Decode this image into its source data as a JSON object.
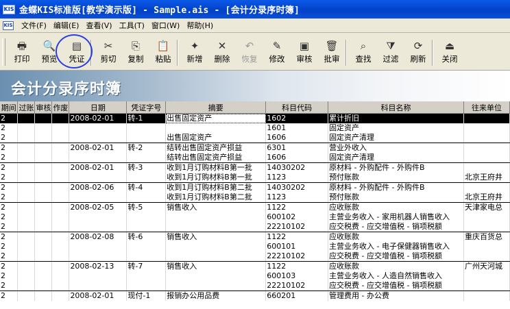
{
  "window": {
    "title": "金蝶KIS标准版[教学演示版] - Sample.ais - [会计分录序时簿]",
    "icon_text": "KIS"
  },
  "menu": {
    "doc_icon_text": "KIS",
    "items": [
      "文件(F)",
      "编辑(E)",
      "查看(V)",
      "工具(T)",
      "窗口(W)",
      "帮助(H)"
    ]
  },
  "toolbar": {
    "buttons": [
      {
        "label": "打印",
        "icon": "printer-icon",
        "glyph": "🖶",
        "disabled": false
      },
      {
        "label": "预览",
        "icon": "preview-icon",
        "glyph": "🔍",
        "disabled": false
      },
      {
        "label": "凭证",
        "icon": "voucher-icon",
        "glyph": "▤",
        "disabled": false
      },
      {
        "label": "剪切",
        "icon": "cut-icon",
        "glyph": "✂",
        "disabled": false
      },
      {
        "label": "复制",
        "icon": "copy-icon",
        "glyph": "⎘",
        "disabled": false
      },
      {
        "label": "粘贴",
        "icon": "paste-icon",
        "glyph": "📋",
        "disabled": false
      },
      {
        "label": "新增",
        "icon": "new-icon",
        "glyph": "✦",
        "disabled": false
      },
      {
        "label": "删除",
        "icon": "delete-icon",
        "glyph": "✕",
        "disabled": false
      },
      {
        "label": "恢复",
        "icon": "restore-icon",
        "glyph": "↶",
        "disabled": true
      },
      {
        "label": "修改",
        "icon": "edit-icon",
        "glyph": "✎",
        "disabled": false
      },
      {
        "label": "审核",
        "icon": "audit-icon",
        "glyph": "▣",
        "disabled": false
      },
      {
        "label": "批审",
        "icon": "batch-audit-icon",
        "glyph": "🗑",
        "disabled": false
      },
      {
        "label": "查找",
        "icon": "find-icon",
        "glyph": "⌕",
        "disabled": false
      },
      {
        "label": "过滤",
        "icon": "filter-icon",
        "glyph": "⧩",
        "disabled": false
      },
      {
        "label": "刷新",
        "icon": "refresh-icon",
        "glyph": "⟳",
        "disabled": false
      },
      {
        "label": "关闭",
        "icon": "close-icon",
        "glyph": "⏏",
        "disabled": false
      }
    ]
  },
  "banner": {
    "title": "会计分录序时簿"
  },
  "grid": {
    "columns": [
      "期间",
      "过账",
      "审核",
      "作废",
      "日期",
      "凭证字号",
      "摘要",
      "科目代码",
      "科目名称",
      "往来单位"
    ],
    "rows": [
      [
        "2",
        "",
        "",
        "",
        "2008-02-01",
        "转-1",
        "出售固定资产",
        "1602",
        "累计折旧",
        ""
      ],
      [
        "2",
        "",
        "",
        "",
        "",
        "",
        "",
        "1601",
        "固定资产",
        ""
      ],
      [
        "2",
        "",
        "",
        "",
        "",
        "",
        "出售固定资产",
        "1606",
        "固定资产清理",
        ""
      ],
      [
        "2",
        "",
        "",
        "",
        "2008-02-01",
        "转-2",
        "结转出售固定资产损益",
        "6301",
        "营业外收入",
        ""
      ],
      [
        "2",
        "",
        "",
        "",
        "",
        "",
        "结转出售固定资产损益",
        "1606",
        "固定资产清理",
        ""
      ],
      [
        "2",
        "",
        "",
        "",
        "2008-02-01",
        "转-3",
        "收到1月订购材料B第一批",
        "14030202",
        "原材料 - 外购配件 - 外购件B",
        ""
      ],
      [
        "2",
        "",
        "",
        "",
        "",
        "",
        "收到1月订购材料B第一批",
        "1123",
        "预付账款",
        "北京王府井"
      ],
      [
        "2",
        "",
        "",
        "",
        "2008-02-06",
        "转-4",
        "收到1月订购材料B第二批",
        "14030202",
        "原材料 - 外购配件 - 外购件B",
        ""
      ],
      [
        "2",
        "",
        "",
        "",
        "",
        "",
        "收到1月订购材料B第二批",
        "1123",
        "预付账款",
        "北京王府井"
      ],
      [
        "2",
        "",
        "",
        "",
        "2008-02-05",
        "转-5",
        "销售收入",
        "1122",
        "应收账款",
        "天津家电总"
      ],
      [
        "2",
        "",
        "",
        "",
        "",
        "",
        "",
        "600102",
        "主营业务收入 - 家用机器人销售收入",
        ""
      ],
      [
        "2",
        "",
        "",
        "",
        "",
        "",
        "",
        "22210102",
        "应交税费 - 应交增值税 - 销项税额",
        ""
      ],
      [
        "2",
        "",
        "",
        "",
        "2008-02-08",
        "转-6",
        "销售收入",
        "1122",
        "应收账款",
        "重庆百货总"
      ],
      [
        "2",
        "",
        "",
        "",
        "",
        "",
        "",
        "600101",
        "主营业务收入 - 电子保健器销售收入",
        ""
      ],
      [
        "2",
        "",
        "",
        "",
        "",
        "",
        "",
        "22210102",
        "应交税费 - 应交增值税 - 销项税额",
        ""
      ],
      [
        "2",
        "",
        "",
        "",
        "2008-02-13",
        "转-7",
        "销售收入",
        "1122",
        "应收账款",
        "广州天河城"
      ],
      [
        "2",
        "",
        "",
        "",
        "",
        "",
        "",
        "600103",
        "主营业务收入 - 人造自然销售收入",
        ""
      ],
      [
        "2",
        "",
        "",
        "",
        "",
        "",
        "",
        "22210102",
        "应交税费 - 应交增值税 - 销项税额",
        ""
      ],
      [
        "2",
        "",
        "",
        "",
        "2008-02-01",
        "现付-1",
        "报销办公用品费",
        "660201",
        "管理费用 - 办公费",
        ""
      ]
    ]
  }
}
